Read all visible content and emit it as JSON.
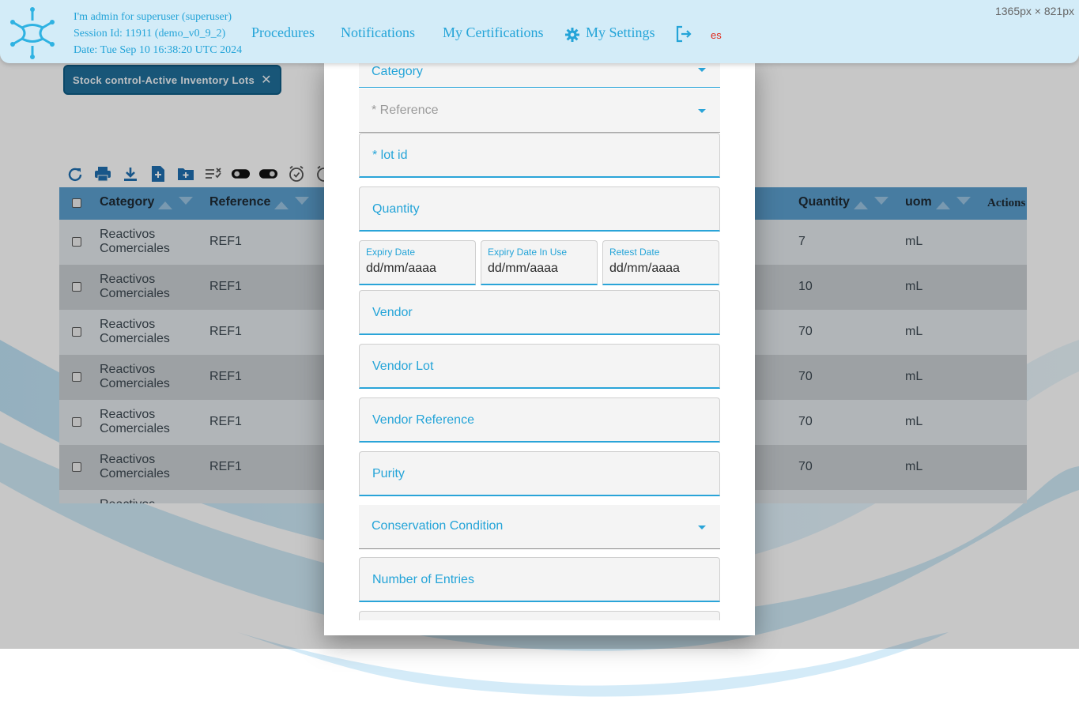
{
  "screen_size_label": "1365px × 821px",
  "header": {
    "session_lines": [
      "I'm admin for superuser (superuser)",
      "Session Id: 11911 (demo_v0_9_2)",
      "Date: Tue Sep 10 16:38:20 UTC 2024"
    ],
    "nav": {
      "procedures": "Procedures",
      "notifications": "Notifications",
      "certifications": "My Certifications",
      "settings": "My Settings"
    },
    "language": "es"
  },
  "chip": {
    "label": "Stock control-Active Inventory Lots",
    "close": "✕"
  },
  "toolbar_icons": [
    "refresh-icon",
    "print-icon",
    "download-icon",
    "new-file-icon",
    "new-folder-icon",
    "filter-check-icon",
    "toggle-on-icon",
    "toggle-off-icon",
    "alarm-icon",
    "alarm-icon-2"
  ],
  "table": {
    "columns": {
      "category": "Category",
      "reference": "Reference",
      "quantity": "Quantity",
      "uom": "uom",
      "actions": "Actions"
    },
    "rows": [
      {
        "category": "Reactivos\nComerciales",
        "reference": "REF1",
        "quantity": "7",
        "uom": "mL"
      },
      {
        "category": "Reactivos\nComerciales",
        "reference": "REF1",
        "quantity": "10",
        "uom": "mL"
      },
      {
        "category": "Reactivos\nComerciales",
        "reference": "REF1",
        "quantity": "70",
        "uom": "mL"
      },
      {
        "category": "Reactivos\nComerciales",
        "reference": "REF1",
        "quantity": "70",
        "uom": "mL"
      },
      {
        "category": "Reactivos\nComerciales",
        "reference": "REF1",
        "quantity": "70",
        "uom": "mL"
      },
      {
        "category": "Reactivos\nComerciales",
        "reference": "REF1",
        "quantity": "70",
        "uom": "mL"
      }
    ],
    "partial_row_text": "Reactivos"
  },
  "dialog": {
    "category": "Category",
    "reference": "* Reference",
    "lot_id": "* lot id",
    "quantity": "Quantity",
    "expiry_date": {
      "label": "Expiry Date",
      "placeholder": "dd/mm/aaaa"
    },
    "expiry_date_in_use": {
      "label": "Expiry Date In Use",
      "placeholder": "dd/mm/aaaa"
    },
    "retest_date": {
      "label": "Retest Date",
      "placeholder": "dd/mm/aaaa"
    },
    "vendor": "Vendor",
    "vendor_lot": "Vendor Lot",
    "vendor_reference": "Vendor Reference",
    "purity": "Purity",
    "conservation_condition": "Conservation Condition",
    "number_of_entries": "Number of Entries"
  },
  "colors": {
    "accent": "#24a4d8",
    "header_bg": "#d3ecf8",
    "table_header": "#5b9fcf",
    "chip_bg": "#1f6f9a",
    "lang": "#e0281c"
  }
}
